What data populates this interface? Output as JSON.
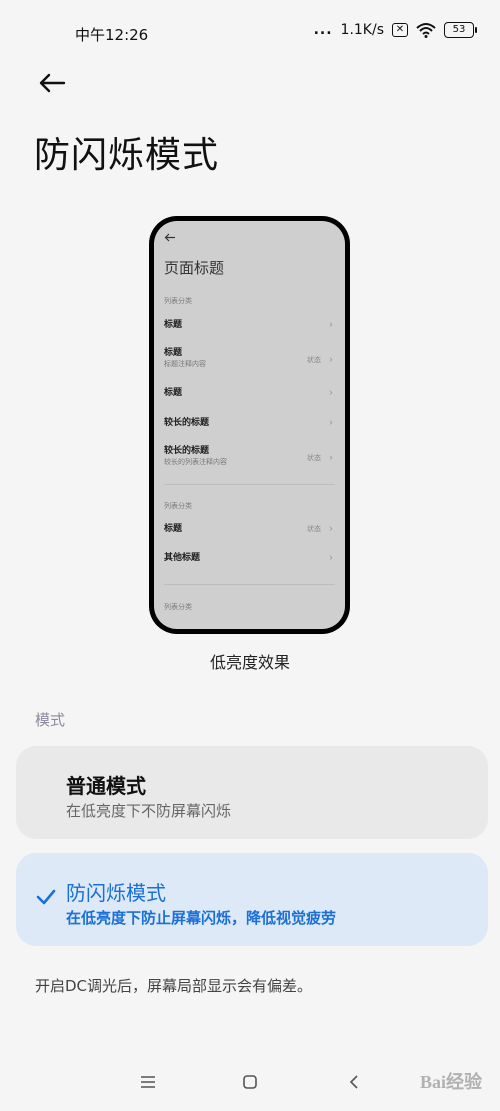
{
  "status_bar": {
    "time": "中午12:26",
    "network_speed": "1.1K/s",
    "battery": "53",
    "signal_dots": "...",
    "sim_icon": "x-box-icon",
    "wifi_icon": "wifi-icon"
  },
  "page": {
    "title": "防闪烁模式",
    "back_icon": "back-arrow-icon"
  },
  "preview": {
    "title": "页面标题",
    "categories": [
      "列表分类",
      "列表分类",
      "列表分类"
    ],
    "items": [
      {
        "label": "标题",
        "sub": "",
        "status": ""
      },
      {
        "label": "标题",
        "sub": "标题注释内容",
        "status": "状态"
      },
      {
        "label": "标题",
        "sub": "",
        "status": ""
      },
      {
        "label": "较长的标题",
        "sub": "",
        "status": ""
      },
      {
        "label": "较长的标题",
        "sub": "较长的列表注释内容",
        "status": "状态"
      },
      {
        "label": "标题",
        "sub": "",
        "status": "状态"
      },
      {
        "label": "其他标题",
        "sub": "",
        "status": ""
      }
    ],
    "caption": "低亮度效果"
  },
  "modes": {
    "section_label": "模式",
    "options": [
      {
        "title": "普通模式",
        "desc": "在低亮度下不防屏幕闪烁",
        "selected": false
      },
      {
        "title": "防闪烁模式",
        "desc": "在低亮度下防止屏幕闪烁，降低视觉疲劳",
        "selected": true
      }
    ]
  },
  "footnote": "开启DC调光后，屏幕局部显示会有偏差。",
  "nav": {
    "menu_icon": "menu-icon",
    "home_icon": "home-icon",
    "back_icon": "back-icon"
  },
  "watermark": "Bai经验",
  "colors": {
    "accent": "#1a6fd8",
    "selected_card": "#dde9f6",
    "card": "#e9e9e9",
    "background": "#f5f5f5"
  }
}
